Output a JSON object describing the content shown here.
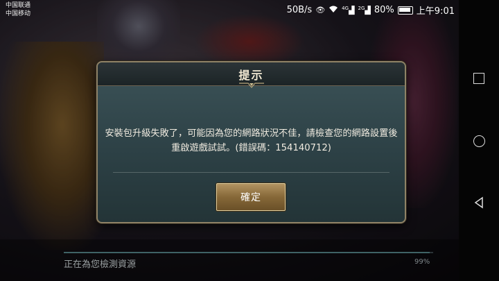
{
  "status_bar": {
    "carrier_1": "中国联通",
    "carrier_2": "中国移动",
    "speed": "50B/s",
    "signal_1": "4G",
    "signal_2": "2G",
    "battery_text": "80%",
    "time": "上午9:01"
  },
  "dialog": {
    "title": "提示",
    "message": "安裝包升級失敗了，可能因為您的網路狀況不佳，請檢查您的網路設置後重啟遊戲試試。(錯誤碼：154140712)",
    "confirm_label": "確定"
  },
  "loading": {
    "label": "正在為您檢測資源",
    "percent_text": "99%",
    "progress": 0.99
  },
  "colors": {
    "dialog_border": "#8f8266",
    "button_gold": "#9a7a48",
    "progress_fill": "#3f6366"
  }
}
